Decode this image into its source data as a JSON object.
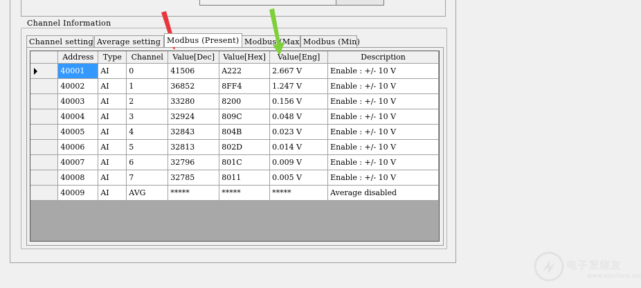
{
  "group": {
    "title": "Channel Information"
  },
  "tabs": [
    {
      "label": "Channel setting",
      "active": false
    },
    {
      "label": "Average setting",
      "active": false
    },
    {
      "label": "Modbus (Present)",
      "active": true
    },
    {
      "label": "Modbus (Max)",
      "active": false
    },
    {
      "label": "Modbus (Min)",
      "active": false
    }
  ],
  "table": {
    "columns": [
      "Address",
      "Type",
      "Channel",
      "Value[Dec]",
      "Value[Hex]",
      "Value[Eng]",
      "Description"
    ],
    "rows": [
      [
        "40001",
        "AI",
        "0",
        "41506",
        "A222",
        "2.667 V",
        "Enable : +/- 10 V"
      ],
      [
        "40002",
        "AI",
        "1",
        "36852",
        "8FF4",
        "1.247 V",
        "Enable : +/- 10 V"
      ],
      [
        "40003",
        "AI",
        "2",
        "33280",
        "8200",
        "0.156 V",
        "Enable : +/- 10 V"
      ],
      [
        "40004",
        "AI",
        "3",
        "32924",
        "809C",
        "0.048 V",
        "Enable : +/- 10 V"
      ],
      [
        "40005",
        "AI",
        "4",
        "32843",
        "804B",
        "0.023 V",
        "Enable : +/- 10 V"
      ],
      [
        "40006",
        "AI",
        "5",
        "32813",
        "802D",
        "0.014 V",
        "Enable : +/- 10 V"
      ],
      [
        "40007",
        "AI",
        "6",
        "32796",
        "801C",
        "0.009 V",
        "Enable : +/- 10 V"
      ],
      [
        "40008",
        "AI",
        "7",
        "32785",
        "8011",
        "0.005 V",
        "Enable : +/- 10 V"
      ],
      [
        "40009",
        "AI",
        "AVG",
        "*****",
        "*****",
        "*****",
        "Average disabled"
      ]
    ],
    "selected_row": 0
  },
  "colors": {
    "selection": "#3399ff",
    "red_arrow": "#e8363c",
    "green_arrow": "#7ed03a"
  },
  "watermark": {
    "text": "电子发烧友",
    "url": "www.elecfans.com"
  }
}
